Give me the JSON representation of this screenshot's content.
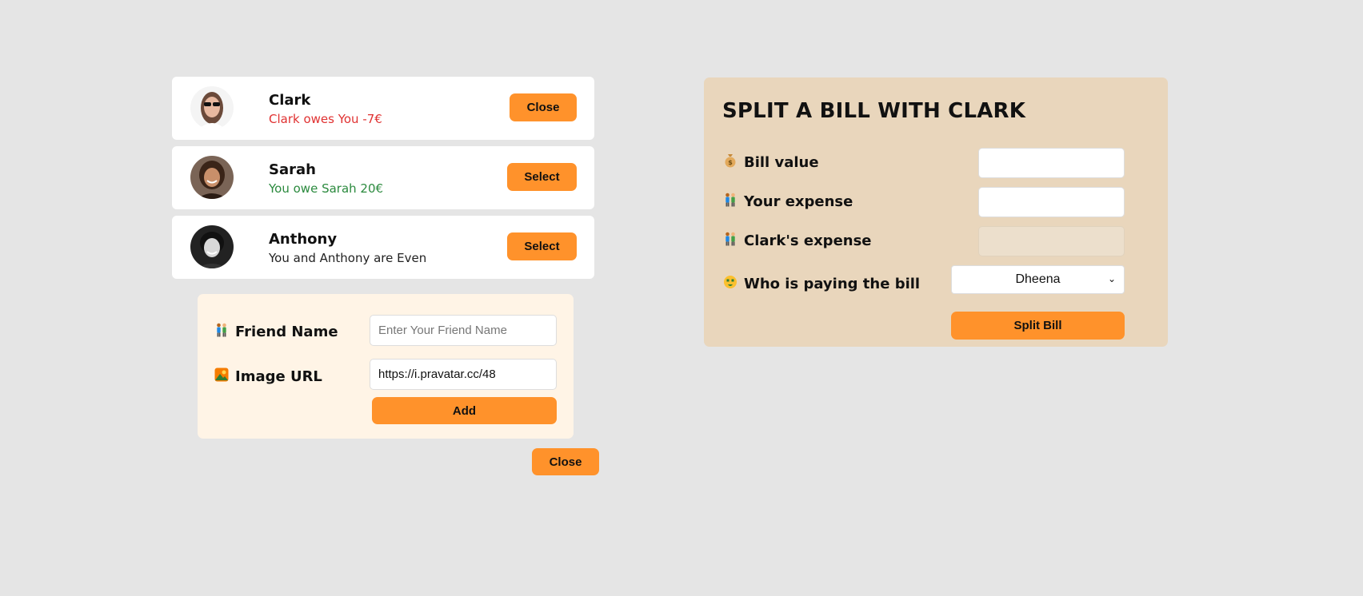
{
  "friends": [
    {
      "name": "Clark",
      "status": "Clark owes You -7€",
      "button": "Close"
    },
    {
      "name": "Sarah",
      "status": "You owe Sarah 20€",
      "button": "Select"
    },
    {
      "name": "Anthony",
      "status": "You and Anthony are Even",
      "button": "Select"
    }
  ],
  "add_friend": {
    "name_label": "Friend Name",
    "name_placeholder": "Enter Your Friend Name",
    "name_icon": "people-icon",
    "url_label": "Image URL",
    "url_value": "https://i.pravatar.cc/48",
    "url_icon": "picture-icon",
    "add_button": "Add",
    "close_button": "Close"
  },
  "split_form": {
    "title": "SPLIT A BILL WITH CLARK",
    "bill_label": "Bill value",
    "your_label": "Your expense",
    "friend_label": "Clark's expense",
    "payer_label": "Who is paying the bill",
    "payer_value": "Dheena",
    "submit": "Split Bill"
  },
  "colors": {
    "accent": "#ff922b",
    "owes_red": "#e03131",
    "owe_green": "#2b8a3e",
    "form_bg": "#fff4e6",
    "split_bg": "#e9d6bc"
  }
}
